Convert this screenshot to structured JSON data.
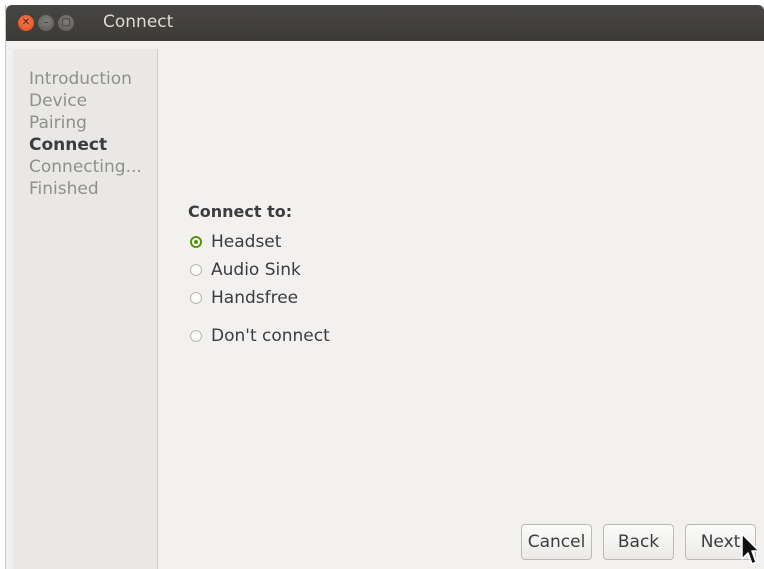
{
  "window": {
    "title": "Connect"
  },
  "sidebar": {
    "steps": [
      {
        "label": "Introduction",
        "active": false
      },
      {
        "label": "Device",
        "active": false
      },
      {
        "label": "Pairing",
        "active": false
      },
      {
        "label": "Connect",
        "active": true
      },
      {
        "label": "Connecting...",
        "active": false
      },
      {
        "label": "Finished",
        "active": false
      }
    ]
  },
  "main": {
    "heading": "Connect to:",
    "options": [
      {
        "label": "Headset",
        "selected": true
      },
      {
        "label": "Audio Sink",
        "selected": false
      },
      {
        "label": "Handsfree",
        "selected": false
      },
      {
        "label": "Don't connect",
        "selected": false
      }
    ]
  },
  "buttons": {
    "cancel": "Cancel",
    "back": "Back",
    "next": "Next"
  },
  "icons": {
    "close": "close-icon",
    "minimize": "minimize-icon",
    "maximize": "maximize-icon",
    "cursor": "mouse-pointer-icon"
  },
  "colors": {
    "accent": "#57930f",
    "titlebar": "#3c3b37",
    "close_button": "#df4a16"
  }
}
